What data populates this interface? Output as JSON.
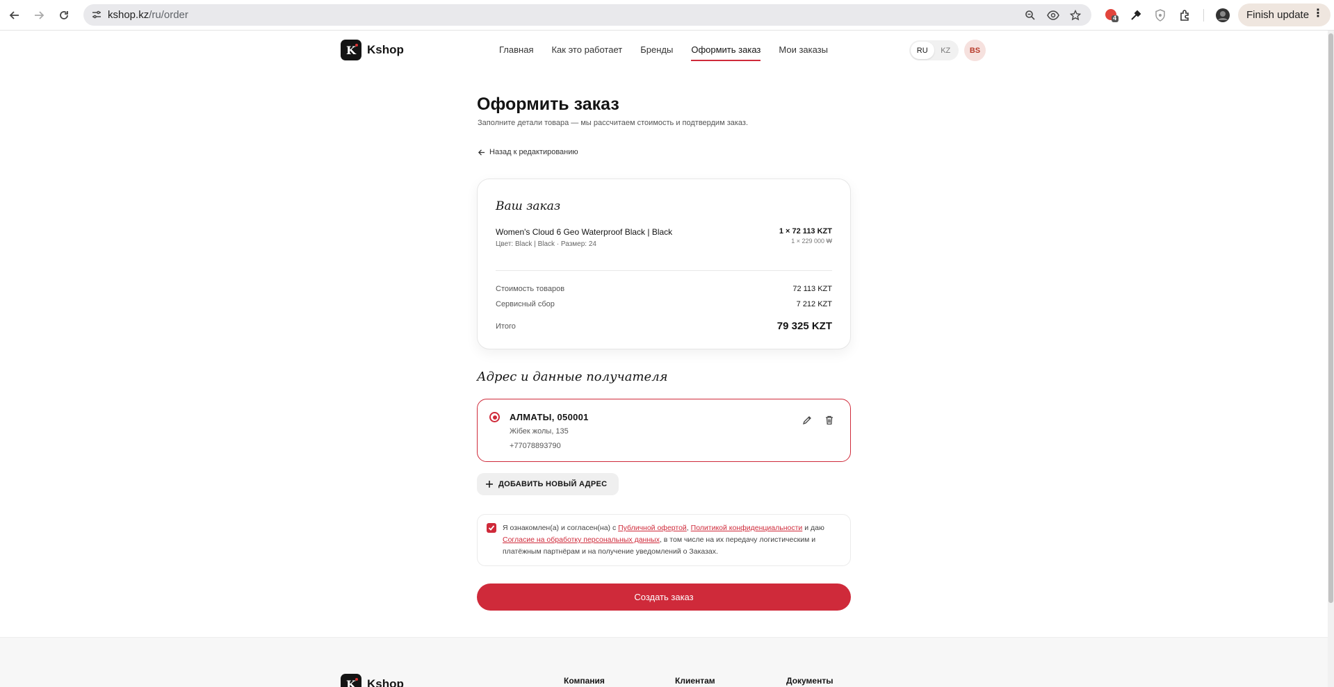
{
  "browser": {
    "url_host": "kshop.kz",
    "url_path": "/ru/order",
    "extension_badge": "4",
    "finish_update": "Finish update"
  },
  "site": {
    "logo_letter": "K",
    "logo_text": "Kshop",
    "nav": [
      "Главная",
      "Как это работает",
      "Бренды",
      "Оформить заказ",
      "Мои заказы"
    ],
    "nav_active": "Оформить заказ",
    "lang_options": [
      "RU",
      "KZ"
    ],
    "lang_selected": "RU",
    "user_initials": "BS"
  },
  "page": {
    "title": "Оформить заказ",
    "subtitle": "Заполните детали товара — мы рассчитаем стоимость и подтвердим заказ.",
    "back_link": "Назад к редактированию"
  },
  "order": {
    "title": "Ваш заказ",
    "product_name": "Women's Cloud 6 Geo Waterproof Black | Black",
    "product_meta": "Цвет: Black | Black · Размер: 24",
    "product_price": "1 × 72 113 KZT",
    "product_price_krw": "1 × 229 000 ₩",
    "goods_label": "Стоимость товаров",
    "goods_value": "72 113 KZT",
    "service_label": "Сервисный сбор",
    "service_value": "7 212 KZT",
    "total_label": "Итого",
    "total_value": "79 325 KZT"
  },
  "address": {
    "section_title": "Адрес и данные получателя",
    "city": "АЛМАТЫ, 050001",
    "street": "Жібек жолы, 135",
    "phone": "+77078893790",
    "add_button": "ДОБАВИТЬ НОВЫЙ АДРЕС"
  },
  "consent": {
    "checked": true,
    "text_1": "Я ознакомлен(а) и согласен(на) с ",
    "link_offer": "Публичной офертой",
    "sep_1": ", ",
    "link_privacy": "Политикой конфиденциальности",
    "text_2": " и даю ",
    "link_personal": "Согласие на обработку персональных данных",
    "text_3": ", в том числе на их передачу логистическим и платёжным партнёрам и на получение уведомлений о Заказах."
  },
  "submit_label": "Создать заказ",
  "footer": {
    "logo_text": "Kshop",
    "columns": [
      "Компания",
      "Клиентам",
      "Документы"
    ]
  },
  "colors": {
    "accent": "#cf2a3a",
    "text": "#141414"
  }
}
